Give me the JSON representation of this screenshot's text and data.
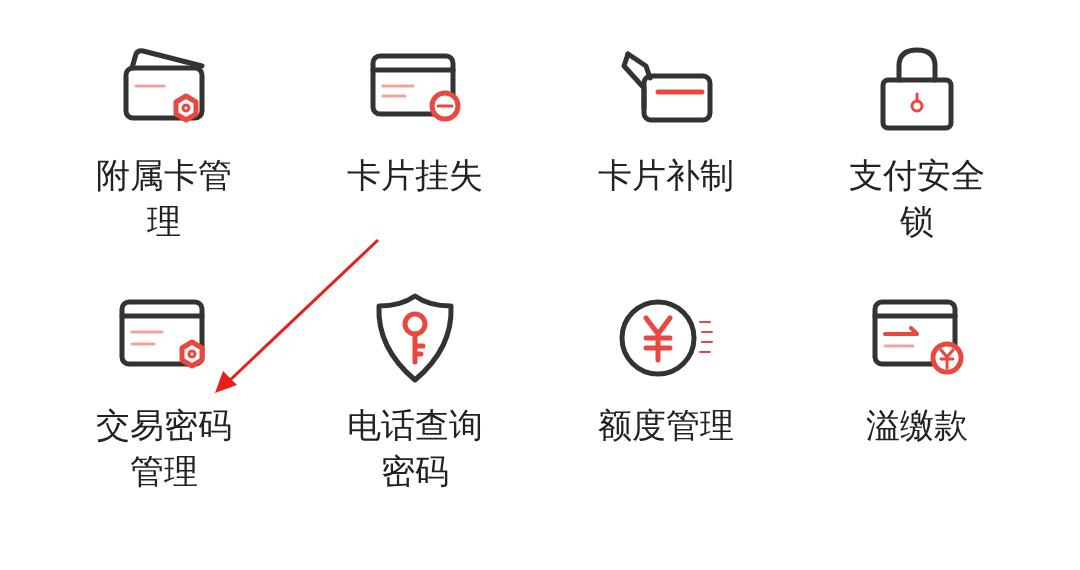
{
  "menu_items": [
    {
      "label": "附属卡管理"
    },
    {
      "label": "卡片挂失"
    },
    {
      "label": "卡片补制"
    },
    {
      "label": "支付安全锁"
    },
    {
      "label": "交易密码管理"
    },
    {
      "label": "电话查询密码"
    },
    {
      "label": "额度管理"
    },
    {
      "label": "溢缴款"
    }
  ]
}
